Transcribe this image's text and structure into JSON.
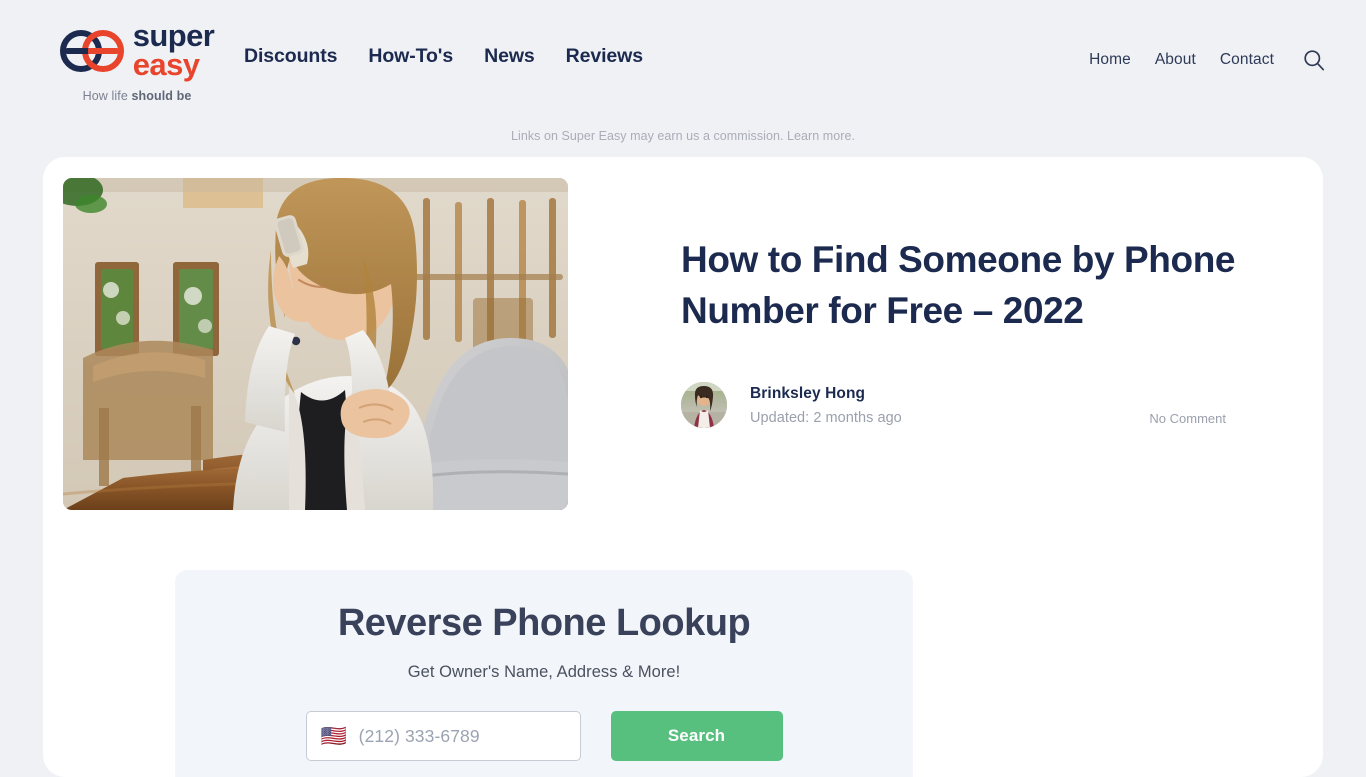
{
  "brand": {
    "name_line1": "super",
    "name_line2": "easy",
    "tagline_plain": "How life ",
    "tagline_bold": "should be",
    "logo_icon": "superexy-double-e-logo",
    "colors": {
      "navy": "#1b2a4e",
      "red": "#e8452c"
    }
  },
  "nav": {
    "primary": [
      {
        "label": "Discounts"
      },
      {
        "label": "How-To's"
      },
      {
        "label": "News"
      },
      {
        "label": "Reviews"
      }
    ],
    "utility": [
      {
        "label": "Home"
      },
      {
        "label": "About"
      },
      {
        "label": "Contact"
      }
    ],
    "search_icon": "search-icon"
  },
  "disclaimer": {
    "text": "Links on Super Easy may earn us a commission. Learn more."
  },
  "article": {
    "title": "How to Find Someone by Phone Number for Free – 2022",
    "hero_alt": "woman-on-phone-with-laptop-photo",
    "author": "Brinksley Hong",
    "updated": "Updated: 2 months ago",
    "comments": "No Comment",
    "avatar_icon": "author-avatar"
  },
  "lookup": {
    "title": "Reverse Phone Lookup",
    "subtitle": "Get Owner's Name, Address & More!",
    "country_flag": "🇺🇸",
    "phone_placeholder": "(212) 333-6789",
    "phone_value": "",
    "search_label": "Search",
    "button_color": "#57c07e"
  }
}
